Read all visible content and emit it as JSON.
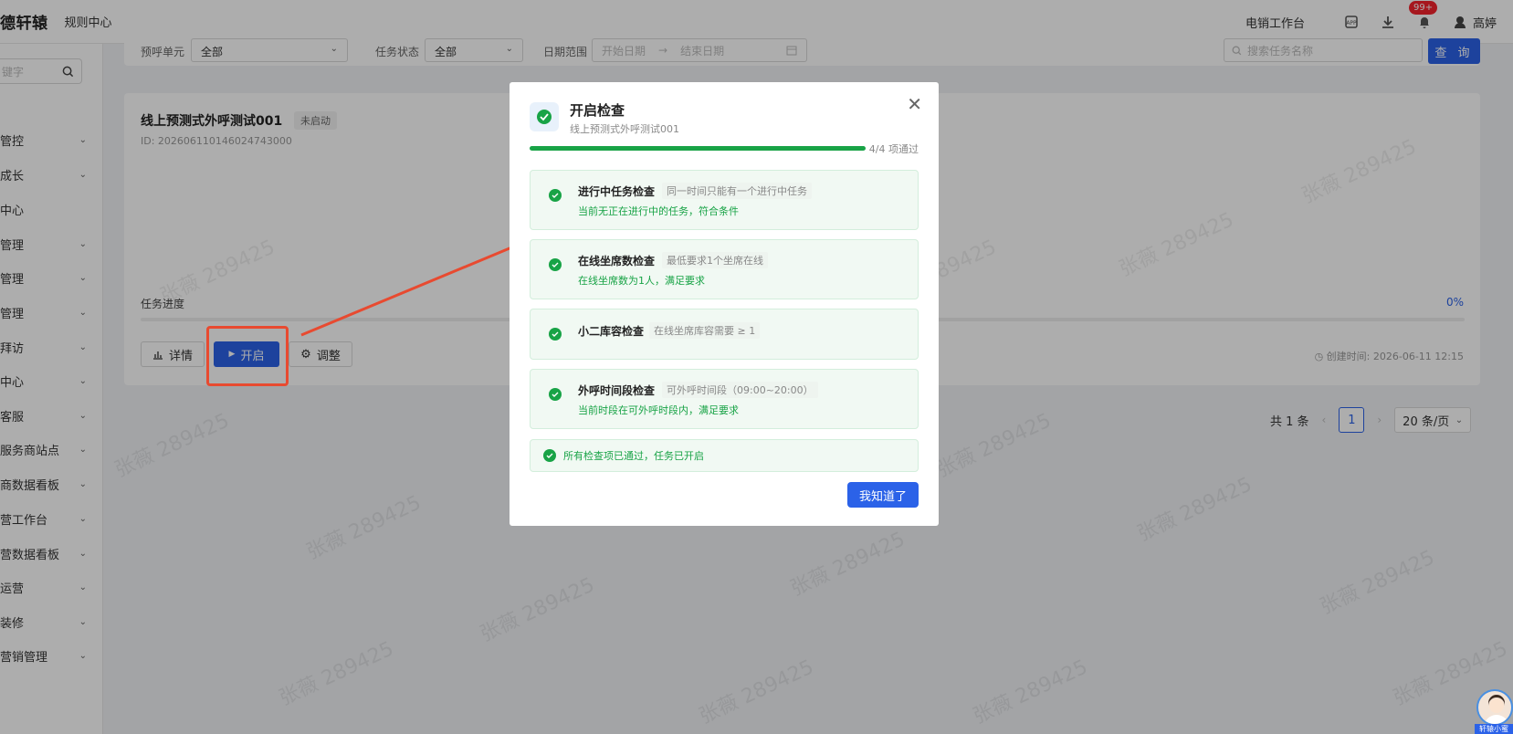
{
  "header": {
    "brand": "德轩辕",
    "rules_center": "规则中心",
    "workbench": "电销工作台",
    "notif_badge": "99+",
    "user_name": "高婷"
  },
  "sidebar": {
    "search_placeholder": "键字",
    "items": [
      {
        "label": "管控",
        "chevron": true
      },
      {
        "label": "成长",
        "chevron": true
      },
      {
        "label": "中心",
        "chevron": false
      },
      {
        "label": "管理",
        "chevron": true
      },
      {
        "label": "管理",
        "chevron": true
      },
      {
        "label": "管理",
        "chevron": true
      },
      {
        "label": "拜访",
        "chevron": true
      },
      {
        "label": "中心",
        "chevron": true
      },
      {
        "label": "客服",
        "chevron": true
      },
      {
        "label": "服务商站点",
        "chevron": true
      },
      {
        "label": "商数据看板",
        "chevron": true
      },
      {
        "label": "营工作台",
        "chevron": true
      },
      {
        "label": "营数据看板",
        "chevron": true
      },
      {
        "label": "运营",
        "chevron": true
      },
      {
        "label": "装修",
        "chevron": true
      },
      {
        "label": "营销管理",
        "chevron": true
      }
    ]
  },
  "filters": {
    "unit_label": "预呼单元",
    "unit_value": "全部",
    "status_label": "任务状态",
    "status_value": "全部",
    "date_label": "日期范围",
    "date_start_placeholder": "开始日期",
    "date_end_placeholder": "结束日期",
    "search_placeholder": "搜索任务名称",
    "query_button": "查 询"
  },
  "task": {
    "title": "线上预测式外呼测试001",
    "status": "未启动",
    "id": "ID: 20260611014602474300​0",
    "progress_label": "任务进度",
    "progress_pct": "0%",
    "progress_value": 0,
    "detail_button": "详情",
    "start_button": "开启",
    "adjust_button": "调整",
    "created_time": "创建时间: 2026-06-11 12:15"
  },
  "pagination": {
    "total": "共 1 条",
    "current_page": "1",
    "page_size": "20 条/页"
  },
  "modal": {
    "title": "开启检查",
    "subtitle": "线上预测式外呼测试001",
    "count": "4/4 项通过",
    "progress_fraction": 1.0,
    "checks": [
      {
        "name": "进行中任务检查",
        "requirement": "同一时间只能有一个进行中任务",
        "result": "当前无正在进行中的任务，符合条件"
      },
      {
        "name": "在线坐席数检查",
        "requirement": "最低要求1个坐席在线",
        "result": "在线坐席数为1人，满足要求"
      },
      {
        "name": "小二库容检查",
        "requirement": "在线坐席库容需要 ≥ 1",
        "result": ""
      },
      {
        "name": "外呼时间段检查",
        "requirement": "可外呼时间段（09:00~20:00）",
        "result": "当前时段在可外呼时段内，满足要求"
      }
    ],
    "final_message": "所有检查项已通过，任务已开启",
    "ok_button": "我知道了"
  },
  "assistant": {
    "label": "轩辕小蜜"
  },
  "watermark": "张薇 289425",
  "colors": {
    "primary": "#2b62e8",
    "success": "#18a346",
    "annotation": "#e84a30"
  }
}
